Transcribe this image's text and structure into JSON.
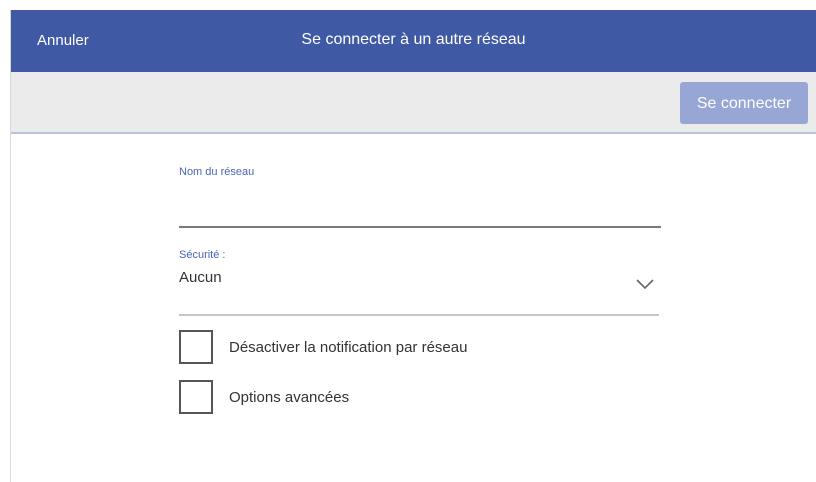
{
  "header": {
    "cancel_label": "Annuler",
    "title": "Se connecter à un autre réseau"
  },
  "toolbar": {
    "connect_label": "Se connecter"
  },
  "form": {
    "network_name_label": "Nom du réseau",
    "network_name_value": "",
    "security_label": "Sécurité :",
    "security_value": "Aucun",
    "checkboxes": [
      {
        "label": "Désactiver la notification par réseau",
        "checked": false
      },
      {
        "label": "Options avancées",
        "checked": false
      }
    ]
  },
  "colors": {
    "header_bg": "#3f59a5",
    "button_bg": "#97a6d4",
    "label_accent": "#4b64b3"
  },
  "icons": {
    "dropdown": "chevron-down-icon"
  }
}
